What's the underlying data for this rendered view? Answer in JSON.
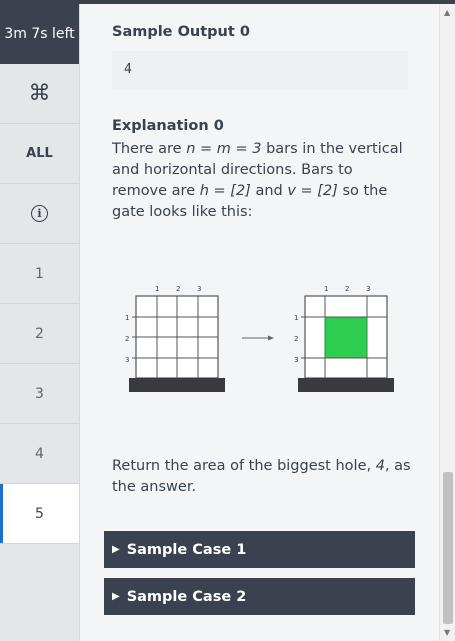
{
  "timer": {
    "label": "3m 7s left"
  },
  "sidebar": {
    "cmd_glyph": "⌘",
    "all_label": "ALL",
    "info_glyph": "i",
    "questions": [
      "1",
      "2",
      "3",
      "4",
      "5"
    ],
    "active_question": "5"
  },
  "content": {
    "sample_output_heading": "Sample Output 0",
    "sample_output_value": "4",
    "explanation_heading": "Explanation 0",
    "explanation": {
      "t1": "There are ",
      "nm": "n = m = 3",
      "t2": " bars in the vertical and horizontal directions. Bars to remove are ",
      "h": "h = [2]",
      "t3": " and ",
      "v": "v = [2]",
      "t4": " so the gate looks like this:"
    },
    "figure": {
      "col_labels": [
        "1",
        "2",
        "3"
      ],
      "row_labels": [
        "1",
        "2",
        "3"
      ],
      "hole_color": "#2ecc50"
    },
    "return": {
      "t1": "Return the area of the biggest hole, ",
      "val": "4",
      "t2": ", as the answer."
    }
  },
  "sample_cases": [
    {
      "label": "Sample Case 1"
    },
    {
      "label": "Sample Case 2"
    }
  ],
  "colors": {
    "dark": "#39424e",
    "accent": "#1f6fd1",
    "hole": "#2ecc50"
  }
}
